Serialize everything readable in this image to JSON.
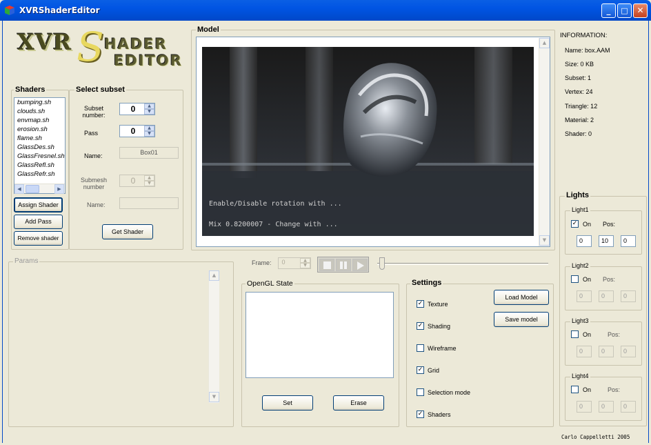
{
  "window": {
    "title": "XVRShaderEditor",
    "minimize": "_",
    "maximize": "□",
    "close": "✕"
  },
  "logo": {
    "text": "XVR SHADER EDITOR",
    "part1": "XVR",
    "part2": "S",
    "part3": "HADER",
    "part4": "EDITOR"
  },
  "shaders": {
    "title": "Shaders",
    "items": [
      "bumping.sh",
      "clouds.sh",
      "envmap.sh",
      "erosion.sh",
      "flame.sh",
      "GlassDes.sh",
      "GlassFresnel.sh",
      "GlassRefl.sh",
      "GlassRefr.sh"
    ],
    "buttons": {
      "assign": "Assign Shader",
      "add_pass": "Add Pass",
      "remove": "Remove shader"
    }
  },
  "subset": {
    "title": "Select subset",
    "subset_label": "Subset number:",
    "subset_value": "0",
    "pass_label": "Pass",
    "pass_value": "0",
    "name_label": "Name:",
    "name_value": "Box01",
    "submesh_label": "Submesh number",
    "submesh_value": "0",
    "name2_label": "Name:",
    "name2_value": "",
    "get_shader": "Get Shader"
  },
  "model": {
    "title": "Model",
    "overlay1": "Enable/Disable rotation with ...",
    "overlay2": "Mix 0.8200007  - Change with ..."
  },
  "information": {
    "title": "INFORMATION:",
    "name": "Name: box.AAM",
    "size": "Size: 0 KB",
    "subset": "Subset: 1",
    "vertex": "Vertex: 24",
    "triangle": "Triangle: 12",
    "material": "Material: 2",
    "shader": "Shader: 0"
  },
  "lights": {
    "title": "Lights",
    "items": [
      {
        "name": "Light1",
        "on": true,
        "on_label": "On",
        "pos_label": "Pos:",
        "pos": [
          "0",
          "10",
          "0"
        ],
        "enabled": true
      },
      {
        "name": "Light2",
        "on": false,
        "on_label": "On",
        "pos_label": "Pos:",
        "pos": [
          "0",
          "0",
          "0"
        ],
        "enabled": false
      },
      {
        "name": "Light3",
        "on": false,
        "on_label": "On",
        "pos_label": "Pos:",
        "pos": [
          "0",
          "0",
          "0"
        ],
        "enabled": false
      },
      {
        "name": "Light4",
        "on": false,
        "on_label": "On",
        "pos_label": "Pos:",
        "pos": [
          "0",
          "0",
          "0"
        ],
        "enabled": false
      }
    ]
  },
  "params": {
    "title": "Params"
  },
  "playback": {
    "frame_label": "Frame:",
    "frame_value": "0",
    "slider_position": 0
  },
  "opengl": {
    "title": "OpenGL State",
    "value": "",
    "set": "Set",
    "erase": "Erase"
  },
  "settings": {
    "title": "Settings",
    "options": [
      {
        "label": "Texture",
        "checked": true
      },
      {
        "label": "Shading",
        "checked": true
      },
      {
        "label": "Wireframe",
        "checked": false
      },
      {
        "label": "Grid",
        "checked": true
      },
      {
        "label": "Selection mode",
        "checked": false
      },
      {
        "label": "Shaders",
        "checked": true
      }
    ],
    "load_model": "Load Model",
    "save_model": "Save model"
  },
  "footer": {
    "credit": "Carlo Cappelletti 2005"
  }
}
